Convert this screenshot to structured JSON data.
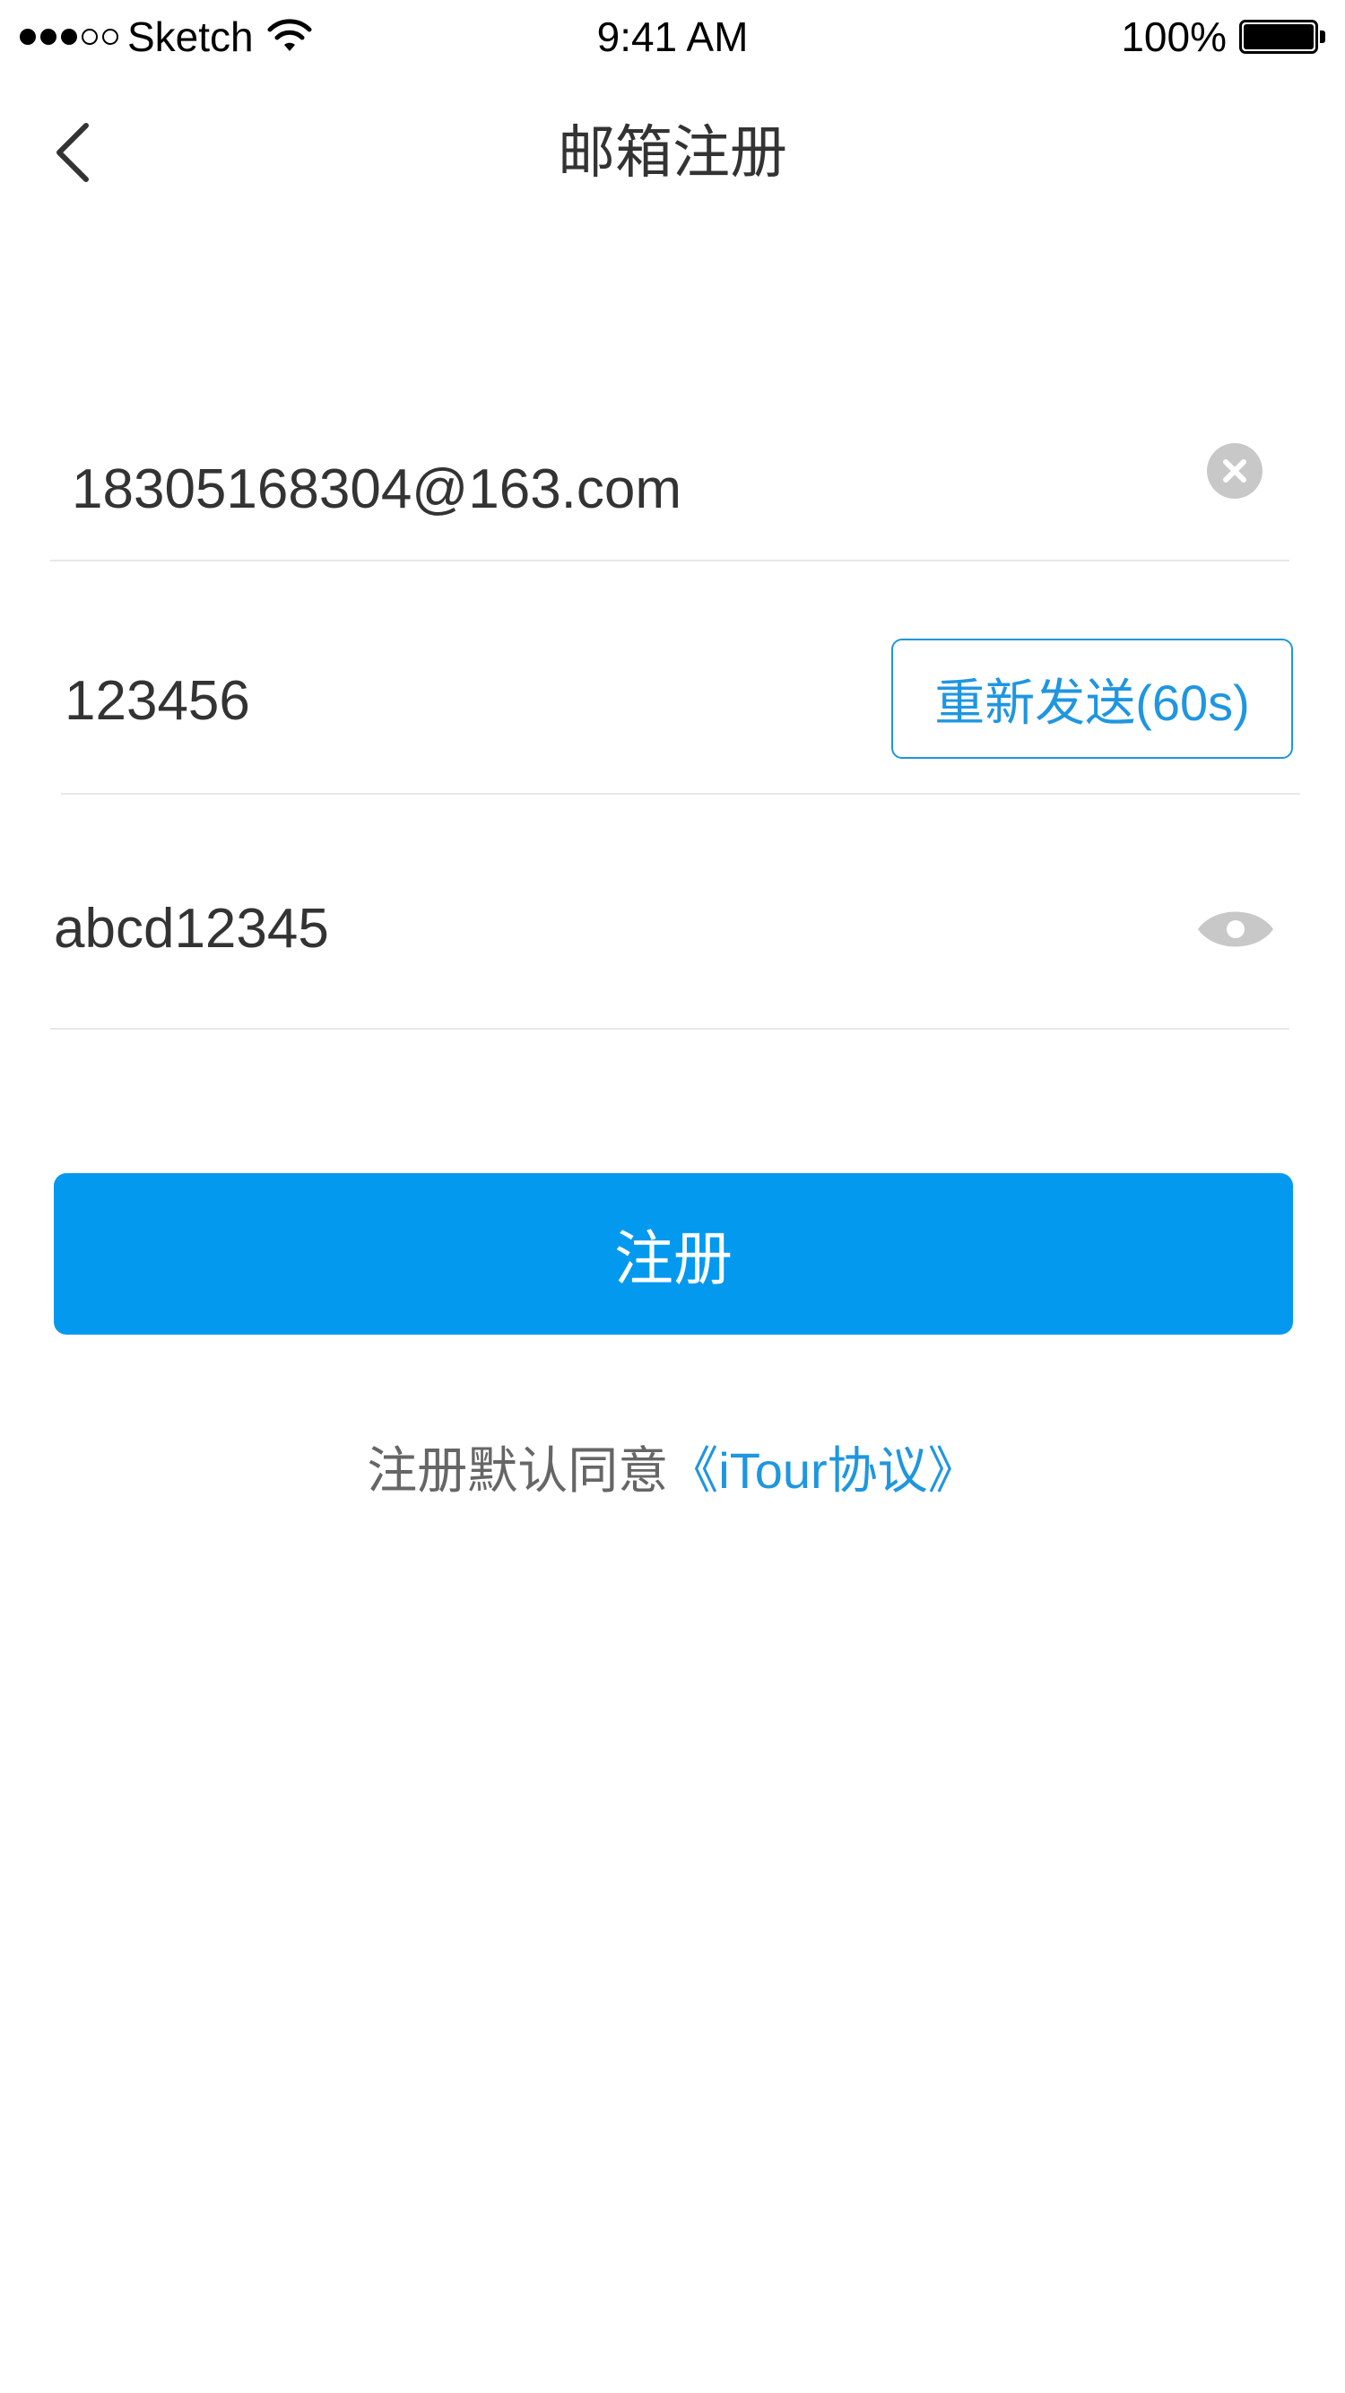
{
  "status_bar": {
    "carrier": "Sketch",
    "time": "9:41 AM",
    "battery_percent": "100%",
    "battery_level": 1.0,
    "signal_bars": 3,
    "signal_total": 5
  },
  "nav": {
    "title": "邮箱注册",
    "back_icon": "chevron-left-icon"
  },
  "form": {
    "email": {
      "value": "18305168304@163.com",
      "clear_icon": "clear-circle-icon"
    },
    "code": {
      "value": "123456",
      "resend_label": "重新发送(60s)"
    },
    "password": {
      "value": "abcd12345",
      "visibility_icon": "eye-icon"
    },
    "submit_label": "注册"
  },
  "agreement": {
    "prefix": "注册默认同意",
    "link": "《iTour协议》"
  },
  "colors": {
    "accent": "#0399ef",
    "link": "#1f96e0",
    "text": "#333333",
    "muted": "#666666",
    "divider": "#e8e8e8",
    "icon_gray": "#c8c8c8"
  }
}
